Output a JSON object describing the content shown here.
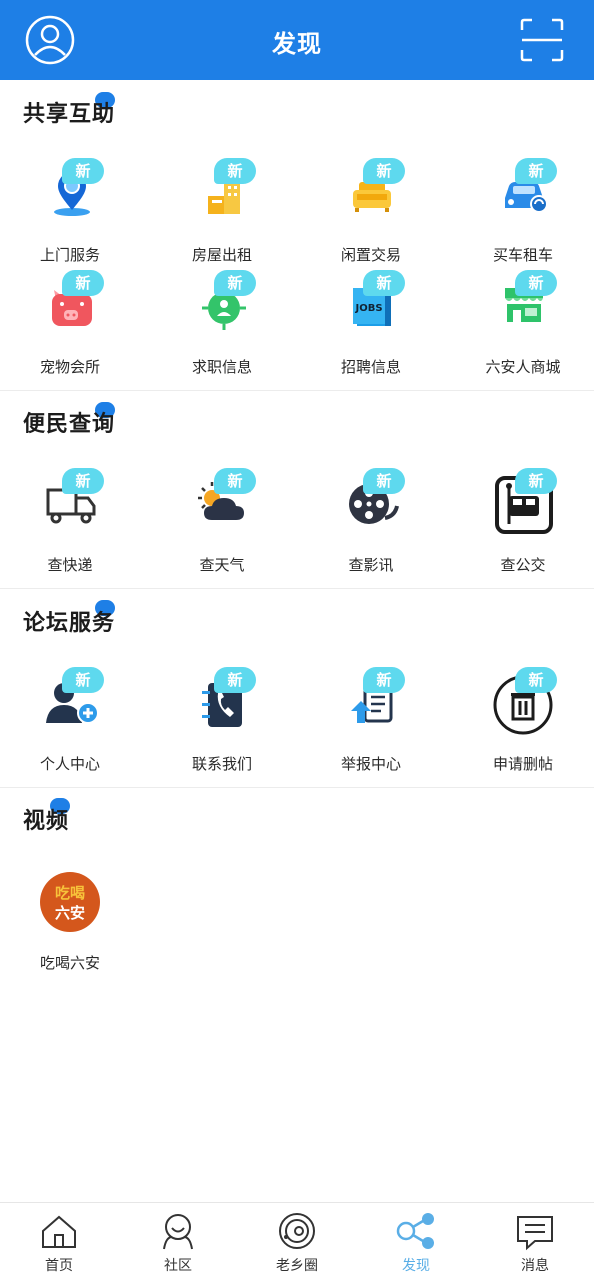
{
  "header": {
    "title": "发现"
  },
  "badge_text": "新",
  "sections": [
    {
      "title": "共享互助",
      "items": [
        {
          "label": "上门服务",
          "icon": "location-pin-icon"
        },
        {
          "label": "房屋出租",
          "icon": "building-icon"
        },
        {
          "label": "闲置交易",
          "icon": "sofa-icon"
        },
        {
          "label": "买车租车",
          "icon": "car-icon"
        },
        {
          "label": "宠物会所",
          "icon": "pig-icon"
        },
        {
          "label": "求职信息",
          "icon": "job-seeker-icon"
        },
        {
          "label": "招聘信息",
          "icon": "jobs-book-icon"
        },
        {
          "label": "六安人商城",
          "icon": "store-icon"
        }
      ]
    },
    {
      "title": "便民查询",
      "items": [
        {
          "label": "查快递",
          "icon": "delivery-truck-icon"
        },
        {
          "label": "查天气",
          "icon": "weather-icon"
        },
        {
          "label": "查影讯",
          "icon": "film-reel-icon"
        },
        {
          "label": "查公交",
          "icon": "bus-icon"
        }
      ]
    },
    {
      "title": "论坛服务",
      "items": [
        {
          "label": "个人中心",
          "icon": "user-add-icon"
        },
        {
          "label": "联系我们",
          "icon": "phone-book-icon"
        },
        {
          "label": "举报中心",
          "icon": "report-icon"
        },
        {
          "label": "申请删帖",
          "icon": "trash-icon"
        }
      ]
    },
    {
      "title": "视频",
      "items": [
        {
          "label": "吃喝六安",
          "icon": "chihe-liuan-logo",
          "logo_text": "吃喝六安"
        }
      ]
    }
  ],
  "tabbar": [
    {
      "label": "首页",
      "icon": "home-icon"
    },
    {
      "label": "社区",
      "icon": "community-icon"
    },
    {
      "label": "老乡圈",
      "icon": "circle-icon"
    },
    {
      "label": "发现",
      "icon": "discover-icon",
      "active": true
    },
    {
      "label": "消息",
      "icon": "message-icon"
    }
  ],
  "colors": {
    "primary": "#1e7fe6",
    "badge": "#5ed9ee",
    "active_tab": "#5aaee6"
  }
}
